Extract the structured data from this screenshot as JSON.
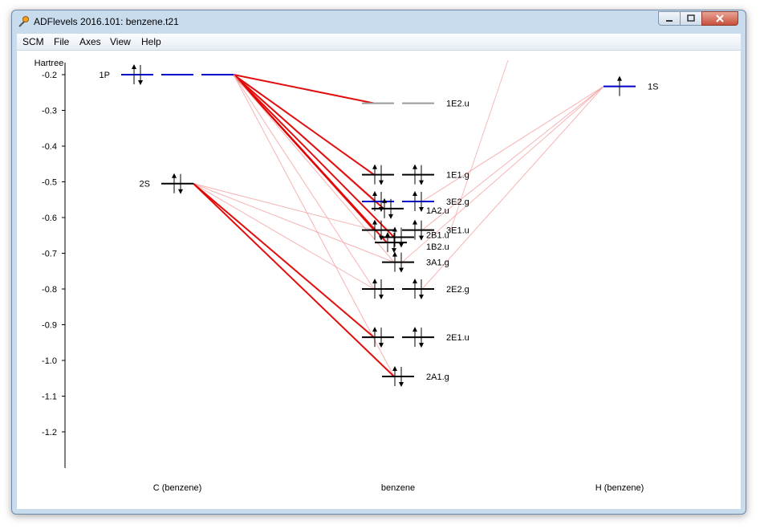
{
  "window": {
    "title": "ADFlevels 2016.101: benzene.t21"
  },
  "menu": [
    "SCM",
    "File",
    "Axes",
    "View",
    "Help"
  ],
  "colors": {
    "occupied_level": "#000000",
    "empty_level": "#9a9a9a",
    "highlight_level": "#0000cc",
    "strong_link": "#e00000",
    "weak_link": "#f4a0a0"
  },
  "chart_data": {
    "type": "energy-level-diagram",
    "ylabel": "Hartree",
    "ylim": [
      -1.3,
      -0.15
    ],
    "yticks": [
      -0.2,
      -0.3,
      -0.4,
      -0.5,
      -0.6,
      -0.7,
      -0.8,
      -0.9,
      -1.0,
      -1.1,
      -1.2
    ],
    "ytick_labels": [
      "-0.2",
      "-0.3",
      "-0.4",
      "-0.5",
      "-0.6",
      "-0.7",
      "-0.8",
      "-0.9",
      "-1.0",
      "-1.1",
      "-1.2"
    ],
    "columns": [
      "C (benzene)",
      "benzene",
      "H (benzene)"
    ],
    "fragment_left_levels": [
      {
        "label": "1P",
        "energy": -0.2,
        "degeneracy": 3,
        "occ": [
          2,
          0,
          0
        ],
        "highlight": true
      },
      {
        "label": "2S",
        "energy": -0.505,
        "degeneracy": 1,
        "occ": [
          2
        ],
        "highlight": false
      }
    ],
    "molecule_levels": [
      {
        "label": "1E2.u",
        "energy": -0.28,
        "degeneracy": 2,
        "occ": [
          0,
          0
        ],
        "highlight": false
      },
      {
        "label": "1E1.g",
        "energy": -0.48,
        "degeneracy": 2,
        "occ": [
          2,
          2
        ],
        "highlight": false
      },
      {
        "label": "3E2.g",
        "energy": -0.555,
        "degeneracy": 2,
        "occ": [
          2,
          2
        ],
        "highlight": true
      },
      {
        "label": "1A2.u",
        "energy": -0.575,
        "degeneracy": 1,
        "occ": [
          2
        ],
        "highlight": false
      },
      {
        "label": "3E1.u",
        "energy": -0.635,
        "degeneracy": 2,
        "occ": [
          2,
          2
        ],
        "highlight": false
      },
      {
        "label": "2B1.u",
        "energy": -0.655,
        "degeneracy": 1,
        "occ": [
          2
        ],
        "highlight": false
      },
      {
        "label": "1B2.u",
        "energy": -0.67,
        "degeneracy": 1,
        "occ": [
          2
        ],
        "highlight": false
      },
      {
        "label": "3A1.g",
        "energy": -0.725,
        "degeneracy": 1,
        "occ": [
          2
        ],
        "highlight": false
      },
      {
        "label": "2E2.g",
        "energy": -0.8,
        "degeneracy": 2,
        "occ": [
          2,
          2
        ],
        "highlight": false
      },
      {
        "label": "2E1.u",
        "energy": -0.935,
        "degeneracy": 2,
        "occ": [
          2,
          2
        ],
        "highlight": false
      },
      {
        "label": "2A1.g",
        "energy": -1.045,
        "degeneracy": 1,
        "occ": [
          2
        ],
        "highlight": false
      }
    ],
    "fragment_right_levels": [
      {
        "label": "1S",
        "energy": -0.233,
        "degeneracy": 1,
        "occ": [
          1
        ],
        "highlight": true
      }
    ],
    "links": [
      {
        "from": "1P",
        "to": "1E2.u",
        "strength": "strong"
      },
      {
        "from": "1P",
        "to": "1E1.g",
        "strength": "strong"
      },
      {
        "from": "1P",
        "to": "3E2.g",
        "strength": "weak"
      },
      {
        "from": "1P",
        "to": "1A2.u",
        "strength": "strong"
      },
      {
        "from": "1P",
        "to": "3E1.u",
        "strength": "strong"
      },
      {
        "from": "1P",
        "to": "2B1.u",
        "strength": "strong"
      },
      {
        "from": "1P",
        "to": "1B2.u",
        "strength": "strong"
      },
      {
        "from": "1P",
        "to": "3A1.g",
        "strength": "weak"
      },
      {
        "from": "1P",
        "to": "2E2.g",
        "strength": "weak"
      },
      {
        "from": "1P",
        "to": "2A1.g",
        "strength": "weak"
      },
      {
        "from": "2S",
        "to": "3E1.u",
        "strength": "weak"
      },
      {
        "from": "2S",
        "to": "2E2.g",
        "strength": "weak"
      },
      {
        "from": "2S",
        "to": "3A1.g",
        "strength": "weak"
      },
      {
        "from": "2S",
        "to": "2E1.u",
        "strength": "strong"
      },
      {
        "from": "2S",
        "to": "2A1.g",
        "strength": "strong"
      },
      {
        "from": "1S",
        "to": "3E2.g",
        "strength": "weak"
      },
      {
        "from": "1S",
        "to": "3E1.u",
        "strength": "weak"
      },
      {
        "from": "1S",
        "to": "2E2.g",
        "strength": "weak"
      },
      {
        "from": "1S",
        "to": "3A1.g",
        "strength": "weak"
      }
    ]
  }
}
